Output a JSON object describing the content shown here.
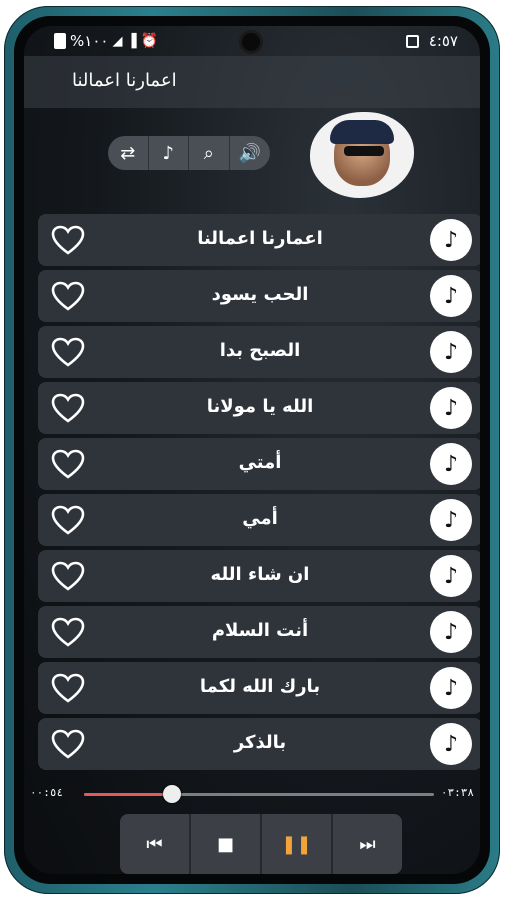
{
  "status_bar": {
    "battery_text": "%١٠٠",
    "time": "٤:٥٧"
  },
  "header": {
    "title": "اعمارنا اعمالنا"
  },
  "controls": [
    {
      "icon": "repeat-icon",
      "glyph": "⇄"
    },
    {
      "icon": "music-note-icon",
      "glyph": "♪"
    },
    {
      "icon": "search-icon",
      "glyph": "⌕"
    },
    {
      "icon": "volume-icon",
      "glyph": "🔊"
    }
  ],
  "songs": [
    {
      "title": "اعمارنا اعمالنا"
    },
    {
      "title": "الحب يسود"
    },
    {
      "title": "الصبح بدا"
    },
    {
      "title": "الله يا مولانا"
    },
    {
      "title": "أمتي"
    },
    {
      "title": "أمي"
    },
    {
      "title": "ان شاء الله"
    },
    {
      "title": "أنت السلام"
    },
    {
      "title": "بارك الله لكما"
    },
    {
      "title": "بالذكر"
    }
  ],
  "progress": {
    "elapsed": "٠٠:٥٤",
    "total": "٠٣:٣٨",
    "fraction": 0.25
  },
  "player": {
    "prev_glyph": "⏮",
    "stop_glyph": "■",
    "pause_glyph": "❚❚",
    "next_glyph": "⏭"
  },
  "colors": {
    "accent_progress": "#e25a5a",
    "pause_color": "#f0a43a",
    "row_bg": "#2f343b"
  }
}
